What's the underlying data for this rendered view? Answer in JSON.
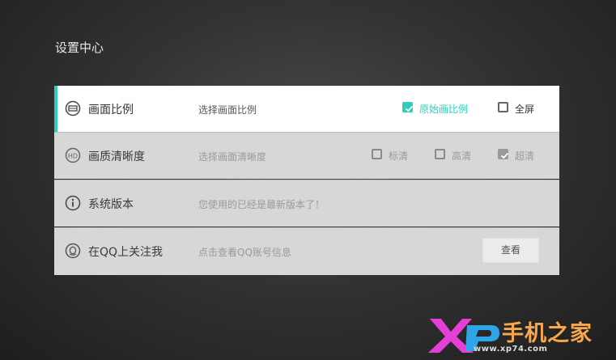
{
  "page": {
    "title": "设置中心"
  },
  "rows": [
    {
      "label": "画面比例",
      "desc": "选择画面比例",
      "options": [
        {
          "label": "原始画比例",
          "checked": true
        },
        {
          "label": "全屏",
          "checked": false
        }
      ]
    },
    {
      "label": "画质清晰度",
      "desc": "选择画面清晰度",
      "options": [
        {
          "label": "标清",
          "checked": false
        },
        {
          "label": "高清",
          "checked": false
        },
        {
          "label": "超清",
          "checked": true
        }
      ]
    },
    {
      "label": "系统版本",
      "desc": "您使用的已经是最新版本了！"
    },
    {
      "label": "在QQ上关注我",
      "desc": "点击查看QQ账号信息",
      "button": "查看"
    }
  ],
  "watermark": {
    "brand": "手机之家",
    "url": "www.xp74.com"
  },
  "colors": {
    "accent": "#2ecfb9",
    "active_row": "#ffffff",
    "inactive_row": "#d7d7d7"
  },
  "icons": [
    "aspect-ratio-icon",
    "hd-icon",
    "info-icon",
    "qq-icon",
    "checkmark-icon"
  ]
}
